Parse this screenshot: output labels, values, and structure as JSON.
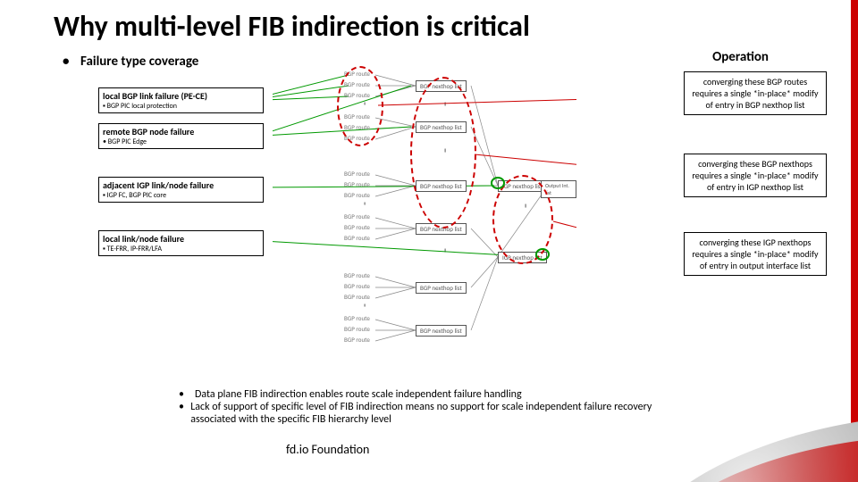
{
  "title": "Why multi-level FIB indirection is critical",
  "subhead_left": "Failure type coverage",
  "subhead_right": "Operation",
  "fail_boxes": [
    {
      "title": "local BGP link failure (PE-CE)",
      "desc": "▪ BGP PIC local protection"
    },
    {
      "title": "remote BGP node failure",
      "desc": "• BGP PIC Edge"
    },
    {
      "title": "adjacent IGP link/node failure",
      "desc": "▪ IGP FC, BGP PIC core"
    },
    {
      "title": "local link/node failure",
      "desc": "▪ TE-FRR, IP-FRR/LFA"
    }
  ],
  "op_boxes": [
    "converging these BGP routes requires a single *in-place* modify of entry in BGP nexthop list",
    "converging these BGP nexthops requires a single *in-place* modify of entry in IGP nexthop list",
    "converging these IGP nexthops requires a single *in-place* modify of entry in output interface list"
  ],
  "diagram_labels": {
    "bgp_route": "BGP route",
    "bgp_nh": "BGP nexthop list",
    "igp_nh": "IGP nexthop list",
    "out_if": "Output Int. list"
  },
  "footer_bullets": [
    "Data plane FIB indirection enables route scale independent failure handling",
    "Lack of support of specific level of FIB indirection means no support for scale independent failure recovery associated with the specific FIB hierarchy level"
  ],
  "foundation": "fd.io Foundation"
}
